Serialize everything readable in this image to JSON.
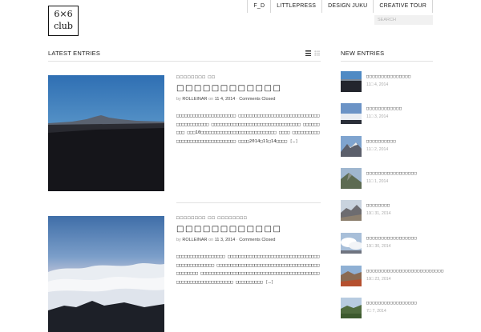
{
  "site": {
    "logo_line1": "6×6",
    "logo_line2": "club"
  },
  "topnav": [
    {
      "label": "F_D"
    },
    {
      "label": "LITTLEPRESS"
    },
    {
      "label": "DESIGN JUKU"
    },
    {
      "label": "CREATIVE TOUR"
    }
  ],
  "search": {
    "placeholder": "SEARCH"
  },
  "main": {
    "section_title": "LATEST ENTRIES",
    "posts": [
      {
        "categories": "□□□□□□□□  □□",
        "title": "□□□□□□□□□□□□",
        "by": "by",
        "author": "ROLLEINAR",
        "on": "on",
        "date": "11 4, 2014",
        "comments": "Comments Closed",
        "excerpt": "□□□□□□□□□□□□□□□□□□□□□□ □□□□□□□□□□□□□□□□□□□□□□□□□□□□□□□□□□□□□□□□□□ □□□□□□□□□□□□□□□□□□□□□□□□□□□□□□□□□ □□□□□□□□□ □□□10□□□□□□□□□□□□□□□□□□□□□□□□□□□□ □□□□ □□□□□□□□□□□□□□□□□□□□□□□□□□□□□□□□ □□□□2014□11□14□□□□",
        "more": "[…]"
      },
      {
        "categories": "□□□□□□□□  □□  □□□□□□□□",
        "title": "□□□□□□□□□□□□",
        "by": "by",
        "author": "ROLLEINAR",
        "on": "on",
        "date": "11 3, 2014",
        "comments": "Comments Closed",
        "excerpt": "□□□□□□□□□□□□□□□□□□  □□□□□□□□□□□□□□□□□□□□□□□□□□□□□□□□□□□□□□□□□□□□□□□□  □□□□□□□□□□□□□□□□□□□□□□□□□□□□□□□□□□□□□□□□□□□□□□  □□□□□□□□□□□□□□□□□□□□□□□□□□□□□□□□□□□□□□□□□□□□□□□□□□□□□□□□□□□□□□□□□ □□□□□□□□□□",
        "more": "[…]"
      }
    ]
  },
  "sidebar": {
    "section_title": "NEW ENTRIES",
    "items": [
      {
        "title": "□□□□□□□□□□□□□□□",
        "date": "11□ 4, 2014"
      },
      {
        "title": "□□□□□□□□□□□□",
        "date": "11□ 3, 2014"
      },
      {
        "title": "□□□□□□□□□□",
        "date": "11□ 2, 2014"
      },
      {
        "title": "□□□□□□□□□□□□□□□□□",
        "date": "11□ 1, 2014"
      },
      {
        "title": "□□□□□□□□",
        "date": "10□ 31, 2014"
      },
      {
        "title": "□□□□□□□□□□□□□□□□□",
        "date": "10□ 30, 2014"
      },
      {
        "title": "□□□□□□□□□□□□□□□□□□□□□□□□□□",
        "date": "10□ 23, 2014"
      },
      {
        "title": "□□□□□□□□□□□□□□□□□",
        "date": "7□ 7, 2014"
      }
    ]
  },
  "colors": {
    "text": "#222222",
    "meta_gray": "#999999",
    "rule": "#e2e2e2",
    "sky_dusk": "#4a88c4",
    "mountain_dark": "#15151a"
  }
}
